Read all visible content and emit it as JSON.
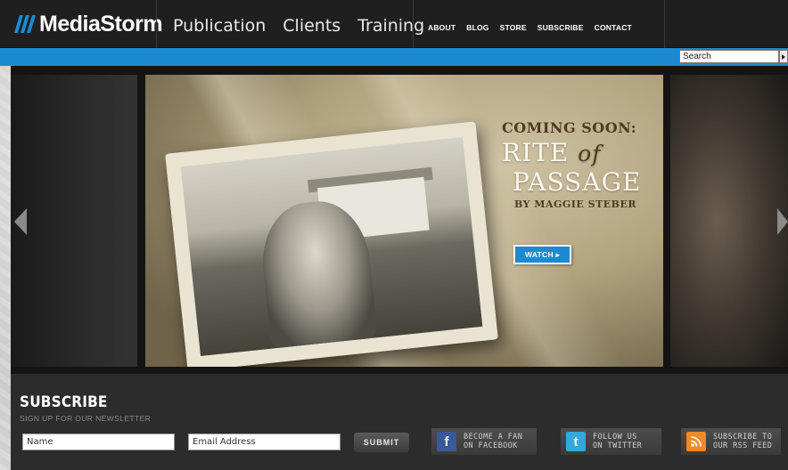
{
  "header": {
    "logo_text": "MediaStorm",
    "main_nav": [
      "Publication",
      "Clients",
      "Training"
    ],
    "sub_nav": [
      "ABOUT",
      "BLOG",
      "STORE",
      "SUBSCRIBE",
      "CONTACT"
    ]
  },
  "search": {
    "placeholder": "Search"
  },
  "slider": {
    "coming": "COMING SOON:",
    "title_a": "RITE",
    "title_of": "of",
    "title_b": "PASSAGE",
    "byline": "BY MAGGIE STEBER",
    "watch_label": "WATCH ▸"
  },
  "subscribe": {
    "title": "SUBSCRIBE",
    "subtitle": "SIGN UP FOR OUR NEWSLETTER",
    "name_placeholder": "Name",
    "email_placeholder": "Email Address",
    "submit_label": "SUBMIT"
  },
  "social": {
    "facebook_line1": "BECOME A FAN",
    "facebook_line2": "ON FACEBOOK",
    "twitter_line1": "FOLLOW US",
    "twitter_line2": "ON TWITTER",
    "rss_line1": "SUBSCRIBE TO",
    "rss_line2": "OUR RSS FEED"
  },
  "colors": {
    "header_bg": "#1f1f1f",
    "accent_blue": "#1b8ad2",
    "footer_bg": "#2c2c2c",
    "facebook": "#3b5998",
    "twitter": "#33a9d9",
    "rss": "#f08a24"
  }
}
